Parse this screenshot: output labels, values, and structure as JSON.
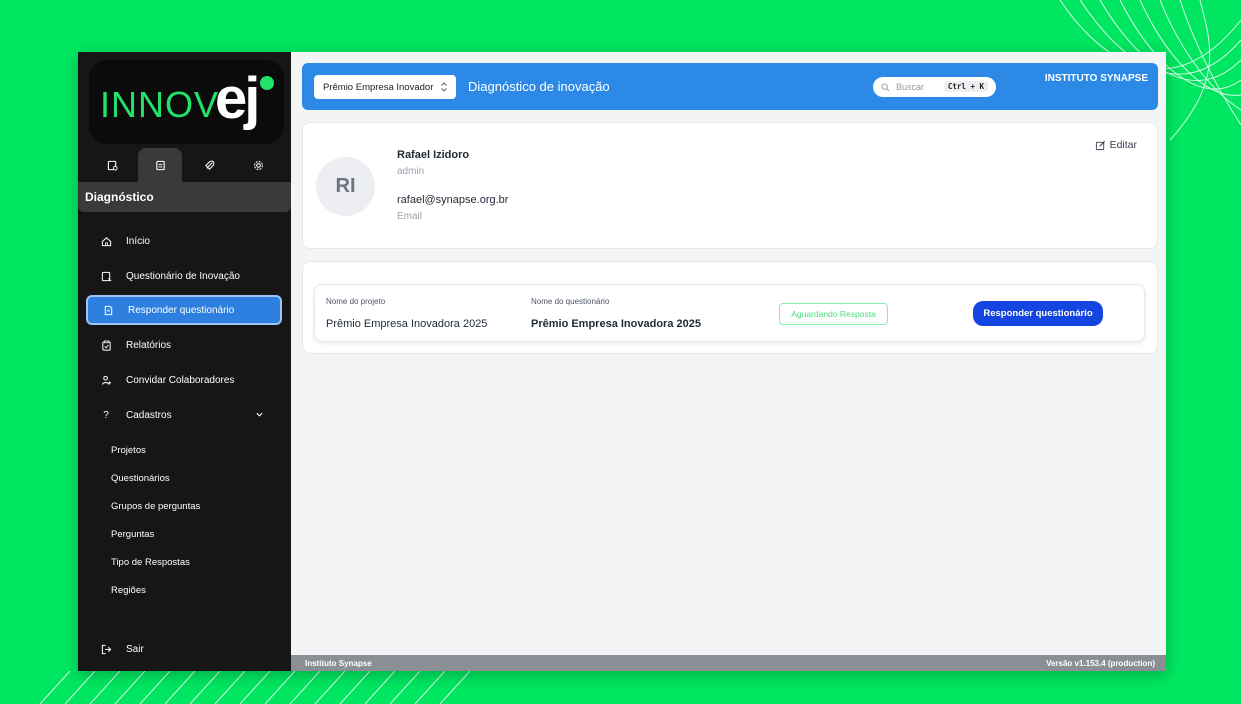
{
  "logo": {
    "text": "INNOV",
    "accent": "ej"
  },
  "sidebar": {
    "top_tabs": [
      "diagnostic-icon",
      "clipboard-icon",
      "rocket-icon",
      "gear-icon"
    ],
    "section_title": "Diagnóstico",
    "items": [
      {
        "label": "Início",
        "icon": "home-icon"
      },
      {
        "label": "Questionário de Inovação",
        "icon": "form-icon"
      },
      {
        "label": "Responder questionário",
        "icon": "document-icon"
      },
      {
        "label": "Relatórios",
        "icon": "clipboard-icon"
      },
      {
        "label": "Convidar Colaboradores",
        "icon": "add-user-icon"
      },
      {
        "label": "Cadastros",
        "icon": "question-icon"
      }
    ],
    "sub_items": [
      "Projetos",
      "Questionários",
      "Grupos de perguntas",
      "Perguntas",
      "Tipo de Respostas",
      "Regiões"
    ],
    "logout": "Sair"
  },
  "header": {
    "project_select": "Prêmio Empresa Inovador",
    "title": "Diagnóstico de inovação",
    "search_placeholder": "Buscar",
    "shortcut": "Ctrl + K",
    "org": "INSTITUTO SYNAPSE"
  },
  "profile": {
    "initials": "RI",
    "name": "Rafael Izidoro",
    "role": "admin",
    "email": "rafael@synapse.org.br",
    "email_label": "Email",
    "edit_label": "Editar"
  },
  "questionnaire": {
    "project_label": "Nome do projeto",
    "project_value": "Prêmio Empresa Inovadora 2025",
    "name_label": "Nome do questionário",
    "name_value": "Prêmio Empresa Inovadora 2025",
    "status": "Aguardando Resposta",
    "action": "Responder questionário"
  },
  "footer": {
    "left": "Instituto Synapse",
    "right": "Versão v1.153.4 (production)"
  },
  "colors": {
    "background": "#00e660",
    "sidebar": "#161616",
    "header": "#2c8ae6",
    "primary_button": "#1445e0",
    "active_nav": "#2d7fe0"
  }
}
